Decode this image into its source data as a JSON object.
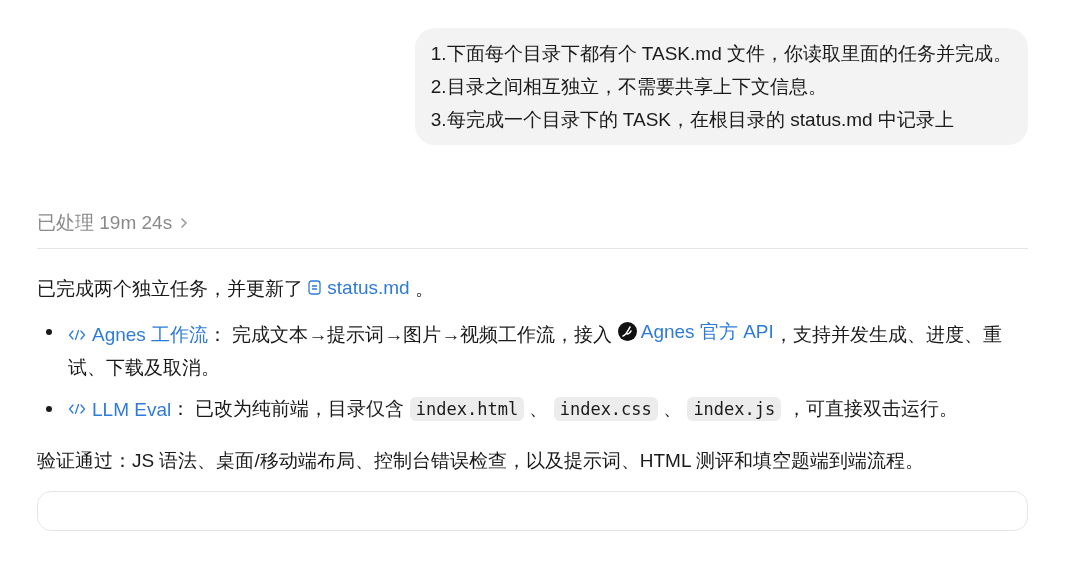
{
  "user_message": {
    "lines": [
      "1.下面每个目录下都有个 TASK.md 文件，你读取里面的任务并完成。",
      "2.目录之间相互独立，不需要共享上下文信息。",
      "3.每完成一个目录下的 TASK，在根目录的 status.md 中记录上"
    ]
  },
  "processing": {
    "label": "已处理 19m 24s",
    "expanded": false
  },
  "summary": [
    {
      "kind": "text",
      "text": "已完成两个独立任务，并更新了 "
    },
    {
      "kind": "file-link",
      "text": "status.md"
    },
    {
      "kind": "text",
      "text": " 。"
    }
  ],
  "bullets": [
    {
      "segments": [
        {
          "kind": "code-link",
          "text": "Agnes 工作流"
        },
        {
          "kind": "text",
          "text": "： 完成文本→提示词→图片→视频工作流，接入 "
        },
        {
          "kind": "logo-link",
          "text": "Agnes 官方 API"
        },
        {
          "kind": "text",
          "text": "，支持并发生成、进度、重试、下载及取消。"
        }
      ]
    },
    {
      "segments": [
        {
          "kind": "code-link",
          "text": "LLM Eval"
        },
        {
          "kind": "text",
          "text": "： 已改为纯前端，目录仅含 "
        },
        {
          "kind": "code",
          "text": "index.html"
        },
        {
          "kind": "text",
          "text": " 、 "
        },
        {
          "kind": "code",
          "text": "index.css"
        },
        {
          "kind": "text",
          "text": " 、 "
        },
        {
          "kind": "code",
          "text": "index.js"
        },
        {
          "kind": "text",
          "text": " ，可直接双击运行。"
        }
      ]
    }
  ],
  "verification": "验证通过：JS 语法、桌面/移动端布局、控制台错误检查，以及提示词、HTML 测评和填空题端到端流程。"
}
